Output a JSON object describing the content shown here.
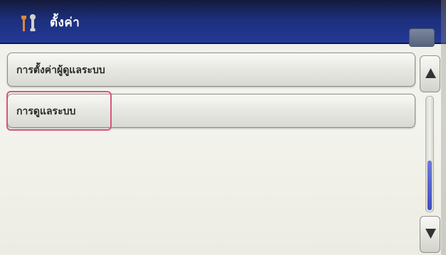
{
  "header": {
    "title": "ตั้งค่า",
    "icon": "tools-icon"
  },
  "menu": {
    "items": [
      {
        "label": "การตั้งค่าผู้ดูแลระบบ"
      },
      {
        "label": "การดูแลระบบ"
      }
    ]
  },
  "scrollbar": {
    "up_icon": "up-arrow-icon",
    "down_icon": "down-arrow-icon"
  },
  "colors": {
    "titlebar": "#1d2f7c",
    "selection": "#d6577d",
    "scroll_thumb": "#3d4cc2"
  }
}
